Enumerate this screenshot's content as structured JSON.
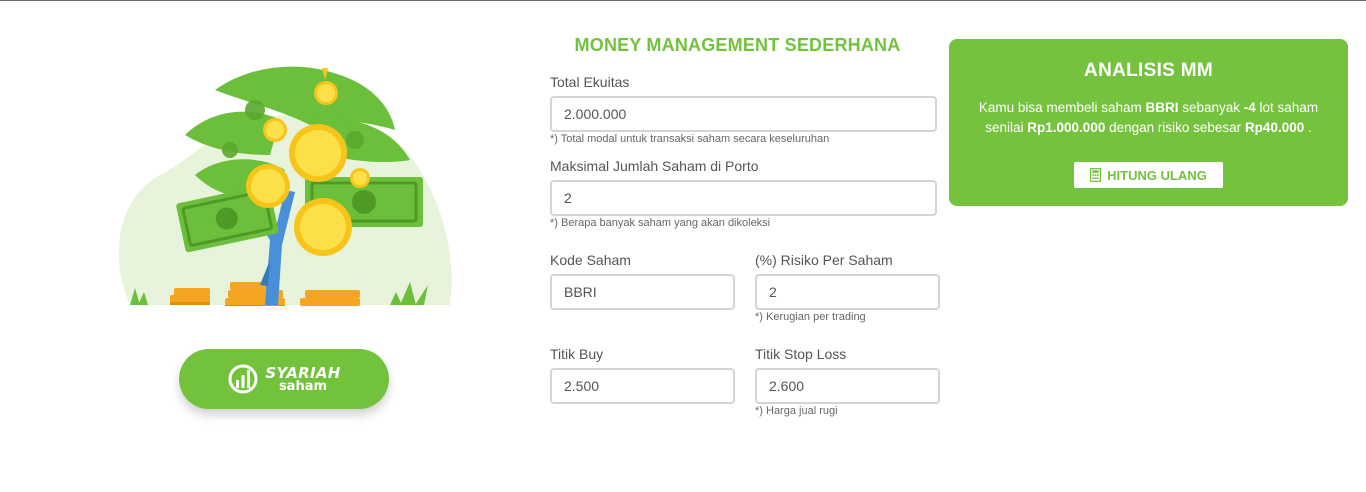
{
  "brand": {
    "line1": "SYARIAH",
    "line2": "saham",
    "color": "#72c23c"
  },
  "form": {
    "title": "MONEY MANAGEMENT SEDERHANA",
    "total_ekuitas": {
      "label": "Total Ekuitas",
      "value": "2.000.000",
      "hint": "*) Total modal untuk transaksi saham secara keseluruhan"
    },
    "maks_saham": {
      "label": "Maksimal Jumlah Saham di Porto",
      "value": "2",
      "hint": "*) Berapa banyak saham yang akan dikoleksi"
    },
    "kode_saham": {
      "label": "Kode Saham",
      "value": "BBRI"
    },
    "risiko": {
      "label": "(%) Risiko Per Saham",
      "value": "2",
      "hint": "*) Kerugian per trading"
    },
    "titik_buy": {
      "label": "Titik Buy",
      "value": "2.500"
    },
    "stop_loss": {
      "label": "Titik Stop Loss",
      "value": "2.600",
      "hint": "*) Harga jual rugi"
    }
  },
  "analysis": {
    "title": "ANALISIS MM",
    "text_1": "Kamu bisa membeli saham ",
    "ticker": "BBRI",
    "text_2": " sebanyak ",
    "lots": "-4",
    "text_3": " lot saham senilai ",
    "amount": "Rp1.000.000",
    "text_4": " dengan risiko sebesar ",
    "risk": "Rp40.000",
    "text_5": " .",
    "button_label": "HITUNG ULANG",
    "button_icon": "calculator-icon",
    "bg_color": "#74c23d"
  }
}
